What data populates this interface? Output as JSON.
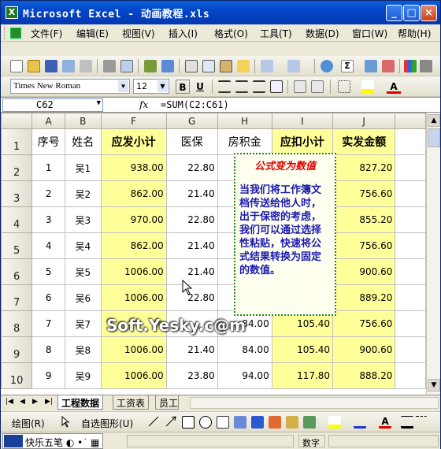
{
  "window": {
    "title": "Microsoft Excel - 动画教程.xls",
    "minimize": "_",
    "maximize": "□",
    "close": "×"
  },
  "menu": [
    "文件(F)",
    "编辑(E)",
    "视图(V)",
    "插入(I)",
    "格式(O)",
    "工具(T)",
    "数据(D)",
    "窗口(W)",
    "帮助(H)"
  ],
  "format_toolbar": {
    "font_name": "Times New Roman",
    "font_size": "12",
    "bold": "B",
    "underline": "U",
    "font_color_label": "A"
  },
  "formula_bar": {
    "name_box": "C62",
    "fx": "fx",
    "formula": "=SUM(C2:C61)"
  },
  "columns": [
    "A",
    "B",
    "F",
    "G",
    "H",
    "I",
    "J"
  ],
  "header_row": {
    "row_number": "1",
    "cells": [
      "序号",
      "姓名",
      "应发小计",
      "医保",
      "房积金",
      "应扣小计",
      "实发金额"
    ]
  },
  "rows": [
    {
      "n": "2",
      "cells": [
        "1",
        "吴1",
        "938.00",
        "22.80",
        "",
        "",
        "827.20"
      ]
    },
    {
      "n": "3",
      "cells": [
        "2",
        "吴2",
        "862.00",
        "21.40",
        "",
        "",
        "756.60"
      ]
    },
    {
      "n": "4",
      "cells": [
        "3",
        "吴3",
        "970.00",
        "22.80",
        "",
        "",
        "855.20"
      ]
    },
    {
      "n": "5",
      "cells": [
        "4",
        "吴4",
        "862.00",
        "21.40",
        "",
        "",
        "756.60"
      ]
    },
    {
      "n": "6",
      "cells": [
        "5",
        "吴5",
        "1006.00",
        "21.40",
        "",
        "",
        "900.60"
      ]
    },
    {
      "n": "7",
      "cells": [
        "6",
        "吴6",
        "1006.00",
        "22.80",
        "",
        "",
        "889.20"
      ]
    },
    {
      "n": "8",
      "cells": [
        "7",
        "吴7",
        "",
        "",
        "84.00",
        "105.40",
        "756.60"
      ]
    },
    {
      "n": "9",
      "cells": [
        "8",
        "吴8",
        "1006.00",
        "21.40",
        "84.00",
        "105.40",
        "900.60"
      ]
    },
    {
      "n": "10",
      "cells": [
        "9",
        "吴9",
        "1006.00",
        "23.80",
        "94.00",
        "117.80",
        "888.20"
      ]
    }
  ],
  "callout": {
    "title": "公式变为数值",
    "body": "当我们将工作簿文档传送给他人时，出于保密的考虑，我们可以通过选择性粘贴，快速将公式结果转换为固定的数值。"
  },
  "watermark": "Soft.Yesky.c@m",
  "sheet_tabs": [
    "工程数据",
    "工资表",
    "员工"
  ],
  "draw_toolbar": {
    "draw_label": "绘图(R)",
    "autoshape_label": "自选图形(U)"
  },
  "status_bar": {
    "ime_name": "快乐五笔",
    "num_indicator": "数字"
  },
  "colors": {
    "highlight_yellow": "#ffff99",
    "callout_border": "#1a8a1a",
    "callout_title": "#e00000",
    "callout_text": "#1a1ab0"
  }
}
